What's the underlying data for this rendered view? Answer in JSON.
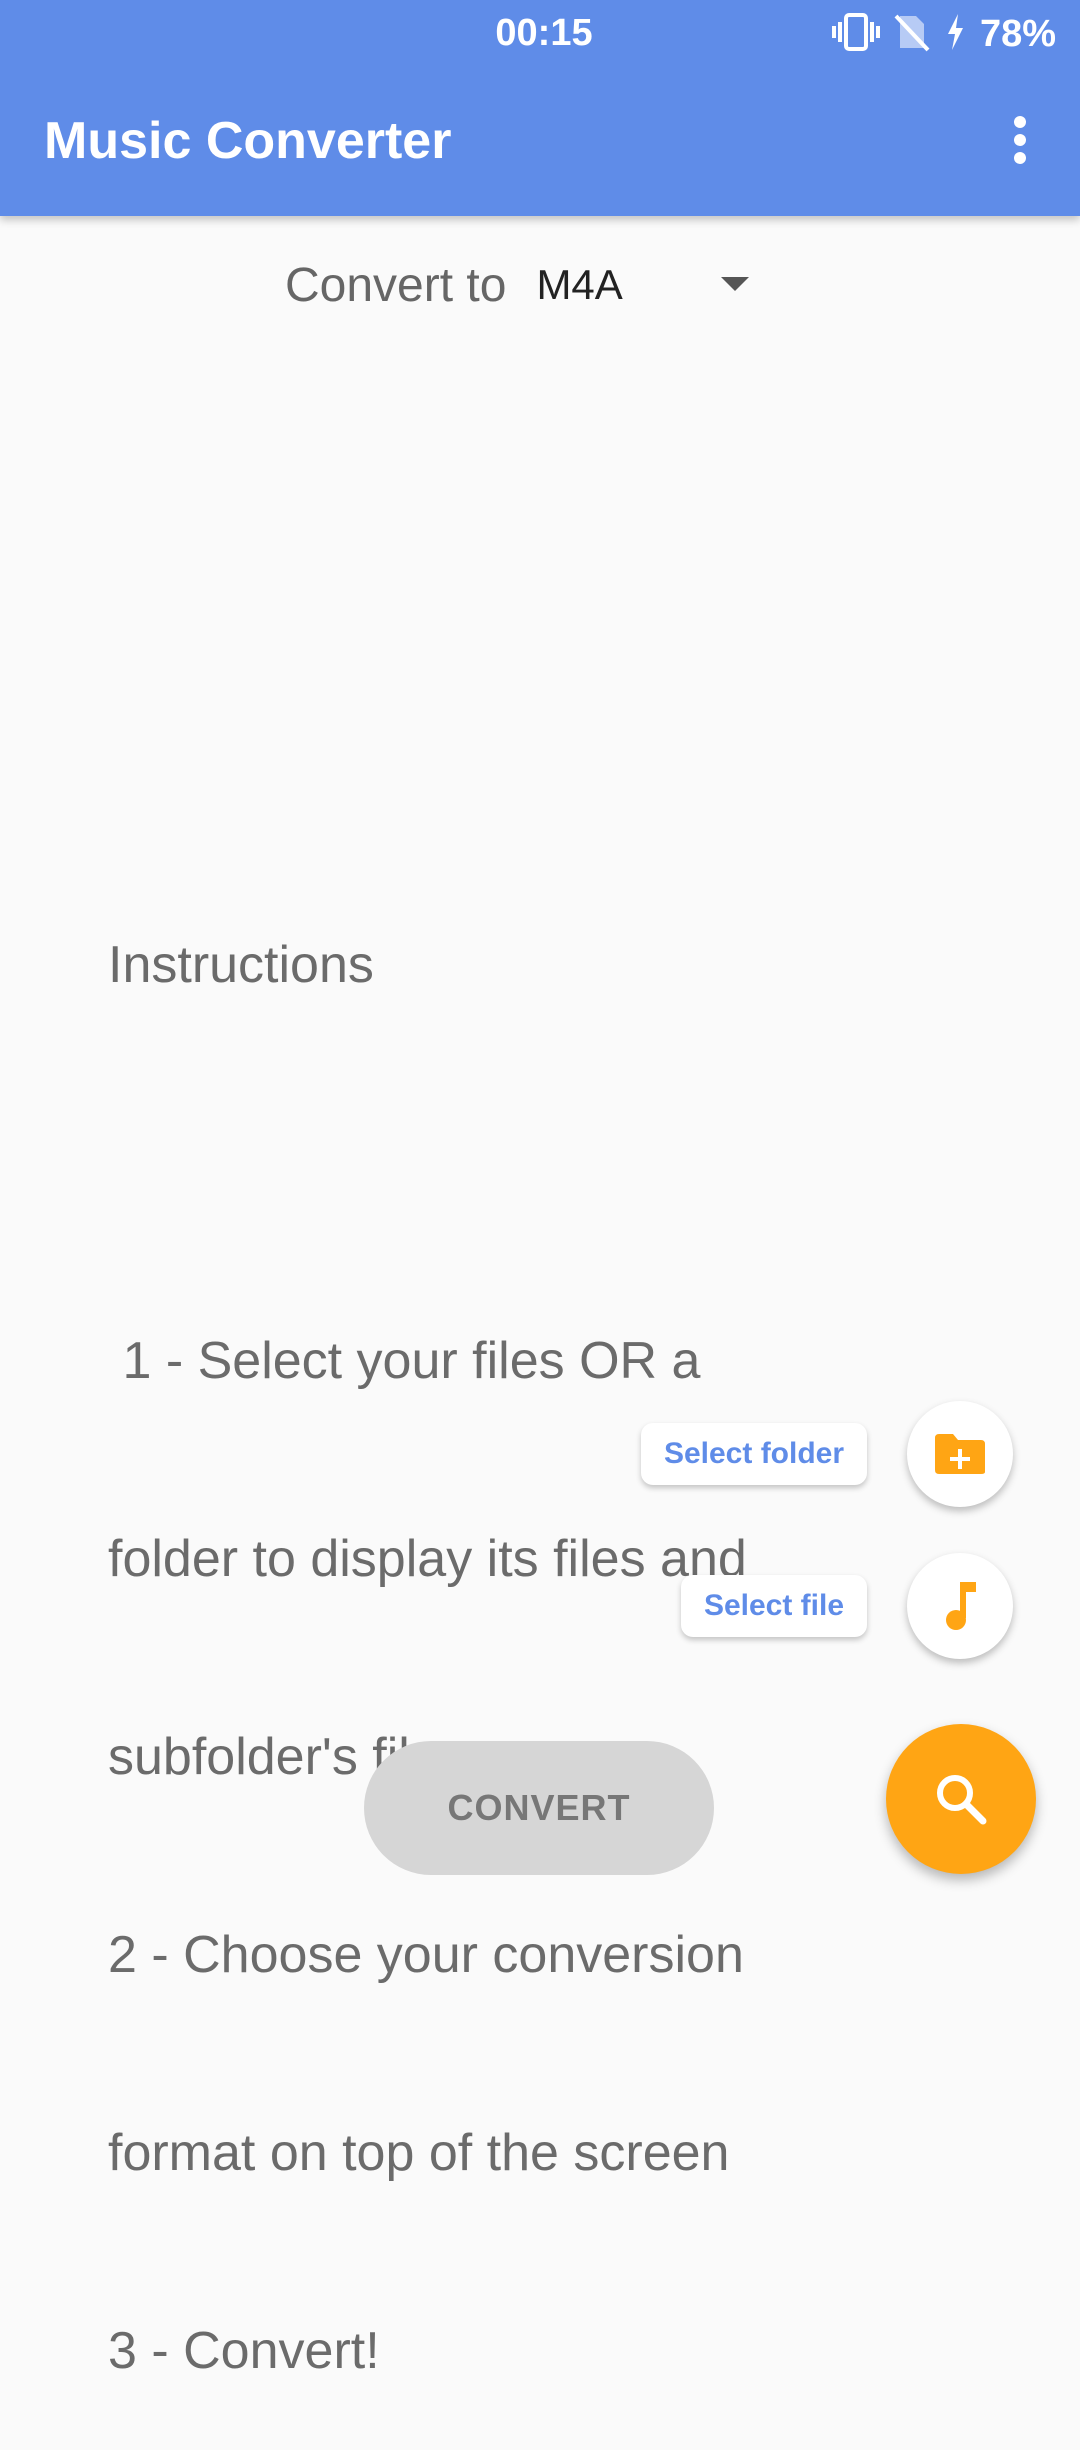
{
  "status_bar": {
    "time": "00:15",
    "battery": "78%",
    "icons": [
      "vibrate-icon",
      "no-sim-icon",
      "charging-icon"
    ]
  },
  "app_bar": {
    "title": "Music Converter",
    "menu_icon": "more-vert-icon"
  },
  "converter": {
    "label": "Convert to",
    "format": "M4A"
  },
  "instructions": {
    "lines": [
      "Instructions",
      "",
      " 1 - Select your files OR a",
      "folder to display its files and",
      "subfolder's files",
      "2 - Choose your conversion",
      "format on top of the screen",
      "3 - Convert!"
    ]
  },
  "actions": {
    "select_folder_label": "Select folder",
    "select_file_label": "Select file",
    "convert_label": "CONVERT",
    "folder_icon": "folder-add-icon",
    "file_icon": "music-note-icon",
    "search_icon": "search-icon"
  },
  "colors": {
    "primary": "#5f8ce8",
    "accent": "#ffa514",
    "background": "#fafafa",
    "disabled_button": "#d6d6d6"
  }
}
